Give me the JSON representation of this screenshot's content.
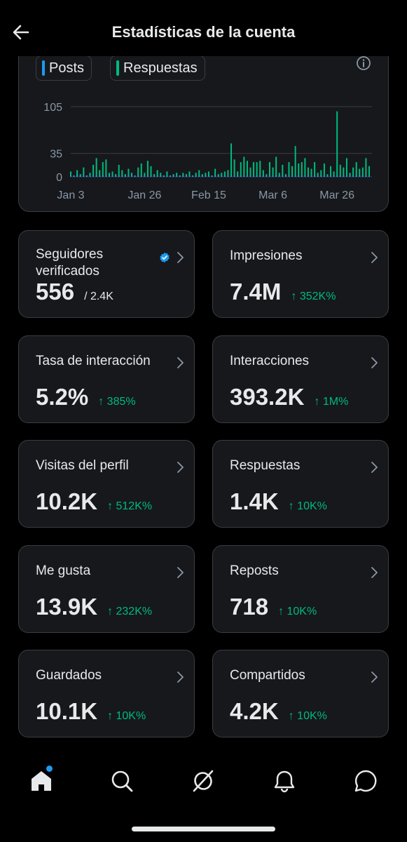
{
  "header": {
    "title": "Estadísticas de la cuenta",
    "back_icon": "arrow-left-icon"
  },
  "chart": {
    "legend": [
      {
        "label": "Posts",
        "color": "#1d9bf0"
      },
      {
        "label": "Respuestas",
        "color": "#00ba7c"
      }
    ],
    "info_icon": "info-circle-icon"
  },
  "chart_data": {
    "type": "bar",
    "y_ticks": [
      "105",
      "35",
      "0"
    ],
    "ylim": [
      0,
      105
    ],
    "x_tick_labels": [
      "Jan 3",
      "Jan 26",
      "Feb 15",
      "Mar 6",
      "Mar 26"
    ],
    "x_tick_days": [
      0,
      23,
      43,
      63,
      83
    ],
    "grid": true,
    "days": 94,
    "series": [
      {
        "name": "Respuestas",
        "color": "#00ba7c",
        "values": [
          8,
          2,
          10,
          4,
          14,
          2,
          6,
          18,
          28,
          10,
          22,
          26,
          6,
          8,
          4,
          18,
          10,
          4,
          12,
          6,
          2,
          14,
          20,
          6,
          24,
          16,
          4,
          10,
          6,
          2,
          8,
          2,
          4,
          6,
          2,
          6,
          4,
          8,
          2,
          6,
          10,
          4,
          6,
          8,
          2,
          12,
          4,
          6,
          8,
          10,
          50,
          26,
          8,
          22,
          30,
          24,
          14,
          22,
          22,
          24,
          10,
          4,
          22,
          14,
          30,
          6,
          18,
          4,
          22,
          16,
          46,
          20,
          22,
          28,
          14,
          12,
          22,
          6,
          10,
          20,
          4,
          16,
          8,
          98,
          18,
          14,
          28,
          6,
          14,
          22,
          12,
          14,
          28,
          16
        ]
      },
      {
        "name": "Posts",
        "color": "#1d9bf0",
        "values": [
          2,
          2,
          3,
          2,
          2,
          2,
          3,
          2,
          2,
          2,
          2,
          2,
          3,
          2,
          2,
          2,
          2,
          2,
          2,
          3,
          2,
          2,
          2,
          2,
          2,
          2,
          2,
          2,
          2,
          2,
          2,
          2,
          2,
          2,
          2,
          2,
          2,
          2,
          2,
          2,
          2,
          2,
          2,
          2,
          2,
          2,
          2,
          2,
          2,
          2,
          2,
          2,
          2,
          2,
          2,
          2,
          2,
          2,
          2,
          2,
          2,
          2,
          2,
          2,
          2,
          2,
          2,
          2,
          2,
          2,
          2,
          2,
          2,
          2,
          2,
          2,
          2,
          2,
          2,
          2,
          2,
          2,
          2,
          2,
          2,
          2,
          2,
          2,
          2,
          2,
          2,
          2,
          2,
          2
        ]
      }
    ]
  },
  "stats": [
    {
      "label": "Seguidores verificados",
      "value": "556",
      "total": "/ 2.4K",
      "verified_icon": "verified-badge-icon"
    },
    {
      "label": "Impresiones",
      "value": "7.4M",
      "change": "↑ 352K%"
    },
    {
      "label": "Tasa de interacción",
      "value": "5.2%",
      "change": "↑ 385%"
    },
    {
      "label": "Interacciones",
      "value": "393.2K",
      "change": "↑ 1M%"
    },
    {
      "label": "Visitas del perfil",
      "value": "10.2K",
      "change": "↑ 512K%"
    },
    {
      "label": "Respuestas",
      "value": "1.4K",
      "change": "↑ 10K%"
    },
    {
      "label": "Me gusta",
      "value": "13.9K",
      "change": "↑ 232K%"
    },
    {
      "label": "Reposts",
      "value": "718",
      "change": "↑ 10K%"
    },
    {
      "label": "Guardados",
      "value": "10.1K",
      "change": "↑ 10K%"
    },
    {
      "label": "Compartidos",
      "value": "4.2K",
      "change": "↑ 10K%"
    }
  ],
  "nav": {
    "items": [
      "home-icon",
      "search-icon",
      "grok-icon",
      "notifications-bell-icon",
      "messages-icon"
    ],
    "notification_dot_color": "#1d9bf0"
  }
}
